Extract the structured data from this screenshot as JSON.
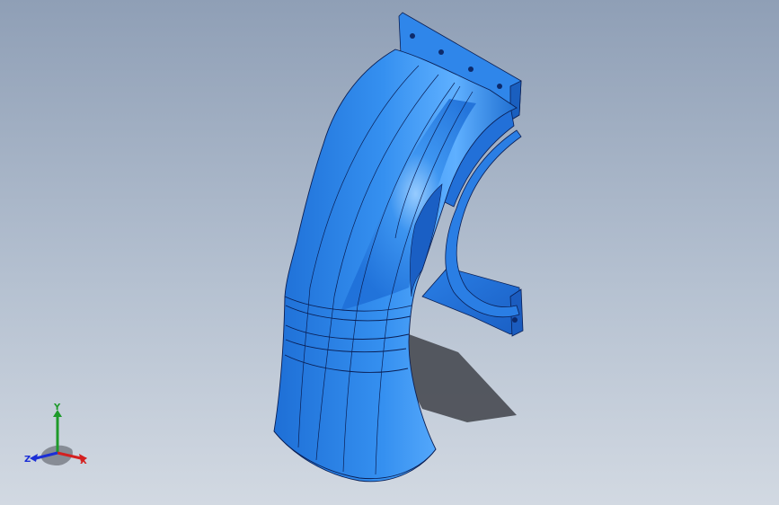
{
  "viewport": {
    "background_top": "#8f9fb6",
    "background_bottom": "#d2d9e2",
    "model_color": "#2f86ea",
    "model_shadow": "#1a5fbf",
    "edge_color": "#0a1f55",
    "shadow_color": "#4a4d55"
  },
  "triad": {
    "x_label": "X",
    "y_label": "Y",
    "z_label": "Z",
    "x_color": "#d42020",
    "y_color": "#1e9a2a",
    "z_color": "#1b2fd6"
  }
}
